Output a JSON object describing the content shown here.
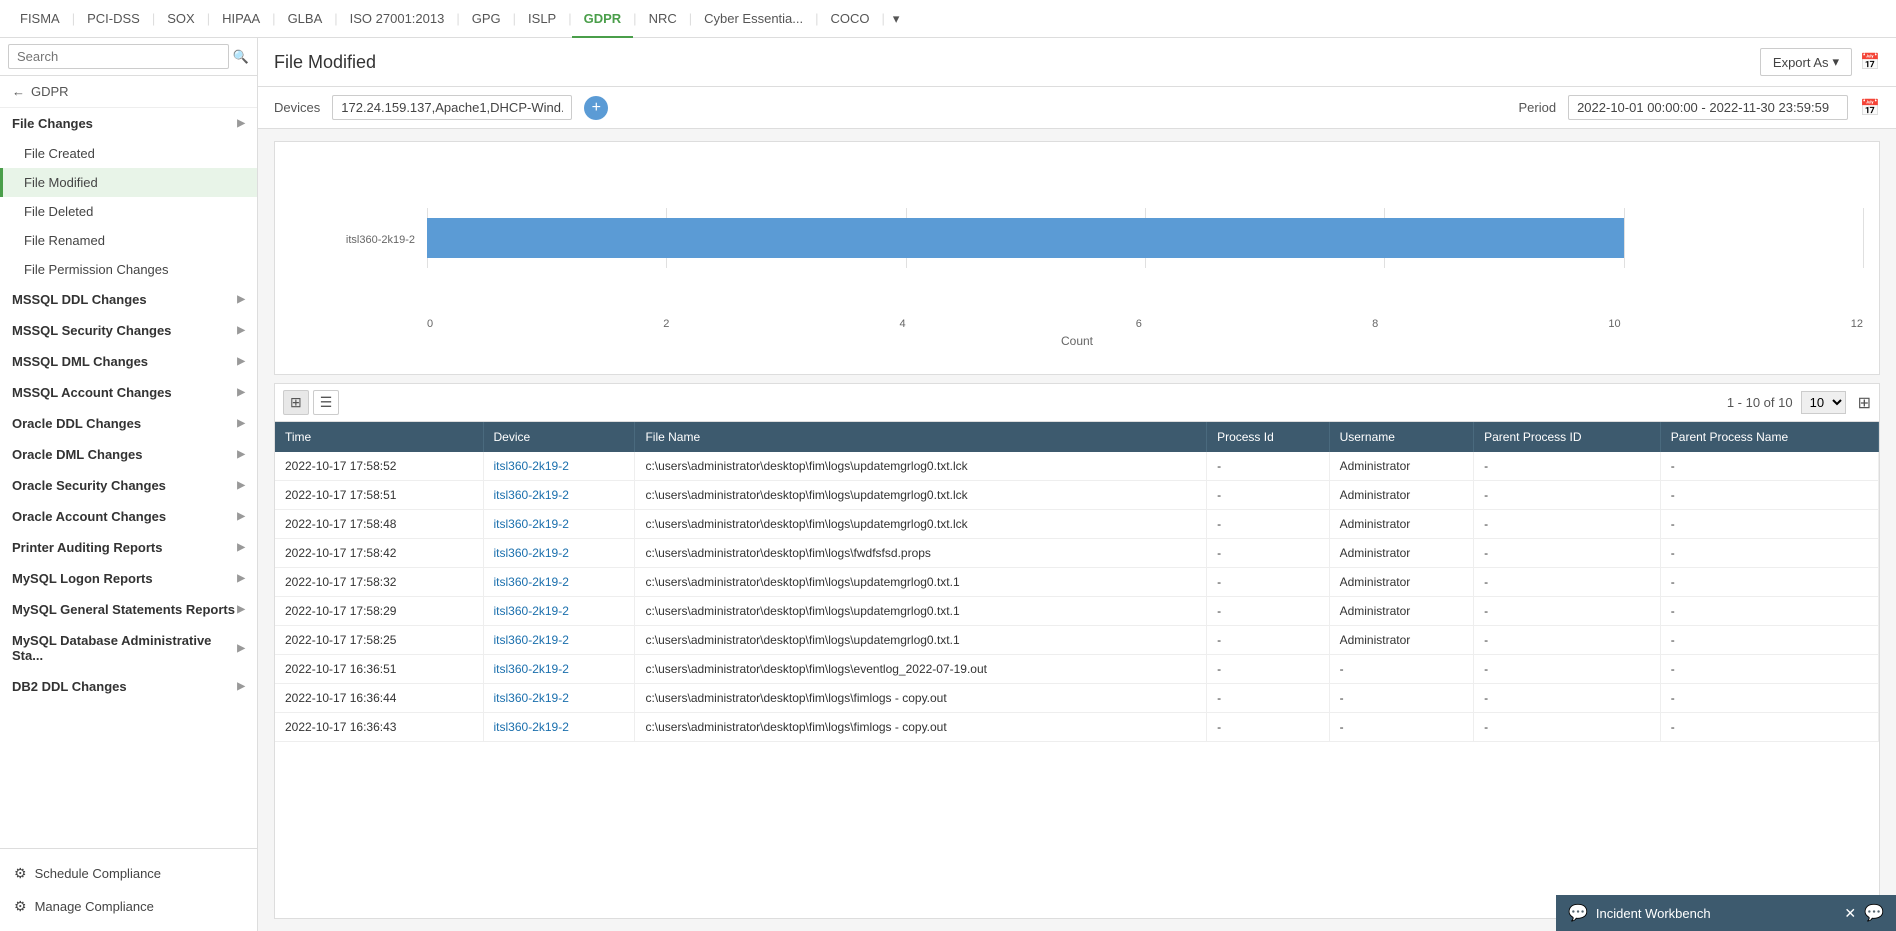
{
  "topNav": {
    "tabs": [
      {
        "label": "FISMA",
        "active": false
      },
      {
        "label": "PCI-DSS",
        "active": false
      },
      {
        "label": "SOX",
        "active": false
      },
      {
        "label": "HIPAA",
        "active": false
      },
      {
        "label": "GLBA",
        "active": false
      },
      {
        "label": "ISO 27001:2013",
        "active": false
      },
      {
        "label": "GPG",
        "active": false
      },
      {
        "label": "ISLP",
        "active": false
      },
      {
        "label": "GDPR",
        "active": true
      },
      {
        "label": "NRC",
        "active": false
      },
      {
        "label": "Cyber Essentia...",
        "active": false
      },
      {
        "label": "COCO",
        "active": false
      }
    ],
    "moreIcon": "▾"
  },
  "sidebar": {
    "searchPlaceholder": "Search",
    "backLabel": "GDPR",
    "sections": [
      {
        "label": "File Changes",
        "expanded": true,
        "items": [
          {
            "label": "File Created",
            "active": false
          },
          {
            "label": "File Modified",
            "active": true
          },
          {
            "label": "File Deleted",
            "active": false
          },
          {
            "label": "File Renamed",
            "active": false
          },
          {
            "label": "File Permission Changes",
            "active": false
          }
        ]
      },
      {
        "label": "MSSQL DDL Changes",
        "expanded": false,
        "items": []
      },
      {
        "label": "MSSQL Security Changes",
        "expanded": false,
        "items": []
      },
      {
        "label": "MSSQL DML Changes",
        "expanded": false,
        "items": []
      },
      {
        "label": "MSSQL Account Changes",
        "expanded": false,
        "items": []
      },
      {
        "label": "Oracle DDL Changes",
        "expanded": false,
        "items": []
      },
      {
        "label": "Oracle DML Changes",
        "expanded": false,
        "items": []
      },
      {
        "label": "Oracle Security Changes",
        "expanded": false,
        "items": []
      },
      {
        "label": "Oracle Account Changes",
        "expanded": false,
        "items": []
      },
      {
        "label": "Printer Auditing Reports",
        "expanded": false,
        "items": []
      },
      {
        "label": "MySQL Logon Reports",
        "expanded": false,
        "items": []
      },
      {
        "label": "MySQL General Statements Reports",
        "expanded": false,
        "items": []
      },
      {
        "label": "MySQL Database Administrative Sta...",
        "expanded": false,
        "items": []
      },
      {
        "label": "DB2 DDL Changes",
        "expanded": false,
        "items": []
      }
    ],
    "footer": [
      {
        "label": "Schedule Compliance",
        "icon": "⚙"
      },
      {
        "label": "Manage Compliance",
        "icon": "⚙"
      }
    ]
  },
  "content": {
    "pageTitle": "File Modified",
    "exportLabel": "Export As",
    "devicesLabel": "Devices",
    "devicesValue": "172.24.159.137,Apache1,DHCP-Wind...",
    "periodLabel": "Period",
    "periodValue": "2022-10-01 00:00:00 - 2022-11-30 23:59:59",
    "chart": {
      "device": "itsl360-2k19-2",
      "barValue": 10,
      "maxValue": 12,
      "xTicks": [
        "0",
        "2",
        "4",
        "6",
        "8",
        "10",
        "12"
      ],
      "xLabel": "Count"
    },
    "table": {
      "pagination": "1 - 10 of 10",
      "pageSize": "10",
      "columns": [
        "Time",
        "Device",
        "File Name",
        "Process Id",
        "Username",
        "Parent Process ID",
        "Parent Process Name"
      ],
      "rows": [
        {
          "time": "2022-10-17 17:58:52",
          "device": "itsl360-2k19-2",
          "fileName": "c:\\users\\administrator\\desktop\\fim\\logs\\updatemgrlog0.txt.lck",
          "processId": "-",
          "username": "Administrator",
          "parentProcessId": "-",
          "parentProcessName": "-"
        },
        {
          "time": "2022-10-17 17:58:51",
          "device": "itsl360-2k19-2",
          "fileName": "c:\\users\\administrator\\desktop\\fim\\logs\\updatemgrlog0.txt.lck",
          "processId": "-",
          "username": "Administrator",
          "parentProcessId": "-",
          "parentProcessName": "-"
        },
        {
          "time": "2022-10-17 17:58:48",
          "device": "itsl360-2k19-2",
          "fileName": "c:\\users\\administrator\\desktop\\fim\\logs\\updatemgrlog0.txt.lck",
          "processId": "-",
          "username": "Administrator",
          "parentProcessId": "-",
          "parentProcessName": "-"
        },
        {
          "time": "2022-10-17 17:58:42",
          "device": "itsl360-2k19-2",
          "fileName": "c:\\users\\administrator\\desktop\\fim\\logs\\fwdfsfsd.props",
          "processId": "-",
          "username": "Administrator",
          "parentProcessId": "-",
          "parentProcessName": "-"
        },
        {
          "time": "2022-10-17 17:58:32",
          "device": "itsl360-2k19-2",
          "fileName": "c:\\users\\administrator\\desktop\\fim\\logs\\updatemgrlog0.txt.1",
          "processId": "-",
          "username": "Administrator",
          "parentProcessId": "-",
          "parentProcessName": "-"
        },
        {
          "time": "2022-10-17 17:58:29",
          "device": "itsl360-2k19-2",
          "fileName": "c:\\users\\administrator\\desktop\\fim\\logs\\updatemgrlog0.txt.1",
          "processId": "-",
          "username": "Administrator",
          "parentProcessId": "-",
          "parentProcessName": "-"
        },
        {
          "time": "2022-10-17 17:58:25",
          "device": "itsl360-2k19-2",
          "fileName": "c:\\users\\administrator\\desktop\\fim\\logs\\updatemgrlog0.txt.1",
          "processId": "-",
          "username": "Administrator",
          "parentProcessId": "-",
          "parentProcessName": "-"
        },
        {
          "time": "2022-10-17 16:36:51",
          "device": "itsl360-2k19-2",
          "fileName": "c:\\users\\administrator\\desktop\\fim\\logs\\eventlog_2022-07-19.out",
          "processId": "-",
          "username": "-",
          "parentProcessId": "-",
          "parentProcessName": "-"
        },
        {
          "time": "2022-10-17 16:36:44",
          "device": "itsl360-2k19-2",
          "fileName": "c:\\users\\administrator\\desktop\\fim\\logs\\fimlogs - copy.out",
          "processId": "-",
          "username": "-",
          "parentProcessId": "-",
          "parentProcessName": "-"
        },
        {
          "time": "2022-10-17 16:36:43",
          "device": "itsl360-2k19-2",
          "fileName": "c:\\users\\administrator\\desktop\\fim\\logs\\fimlogs - copy.out",
          "processId": "-",
          "username": "-",
          "parentProcessId": "-",
          "parentProcessName": "-"
        }
      ]
    }
  },
  "incidentWorkbench": {
    "label": "Incident Workbench"
  }
}
